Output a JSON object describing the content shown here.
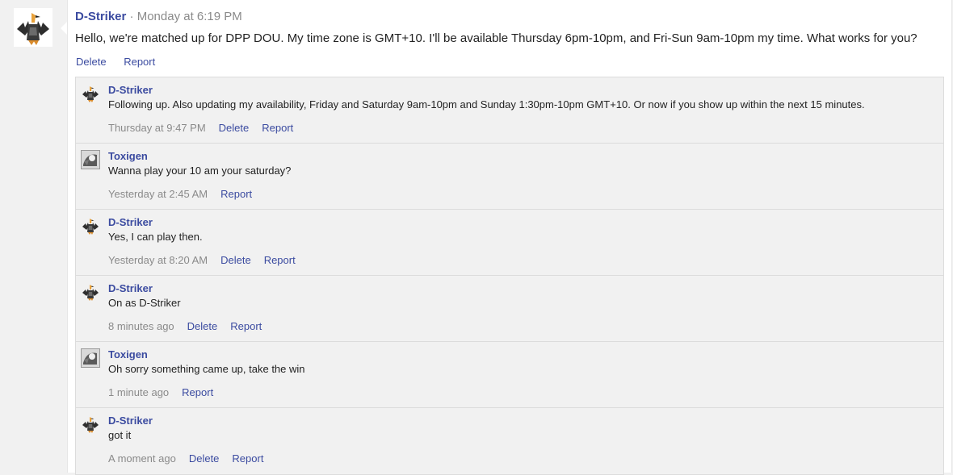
{
  "main_post": {
    "author": "D-Striker",
    "separator": "·",
    "time": "Monday at 6:19 PM",
    "body": "Hello, we're matched up for DPP DOU. My time zone is GMT+10. I'll be available Thursday 6pm-10pm, and Fri-Sun 9am-10pm my time. What works for you?",
    "actions": {
      "delete": "Delete",
      "report": "Report"
    }
  },
  "replies": [
    {
      "author": "D-Striker",
      "avatar": "striker",
      "text": "Following up. Also updating my availability, Friday and Saturday 9am-10pm and Sunday 1:30pm-10pm GMT+10. Or now if you show up within the next 15 minutes.",
      "time": "Thursday at 9:47 PM",
      "delete": "Delete",
      "report": "Report"
    },
    {
      "author": "Toxigen",
      "avatar": "toxigen",
      "text": "Wanna play your 10 am your saturday?",
      "time": "Yesterday at 2:45 AM",
      "delete": null,
      "report": "Report"
    },
    {
      "author": "D-Striker",
      "avatar": "striker",
      "text": "Yes, I can play then.",
      "time": "Yesterday at 8:20 AM",
      "delete": "Delete",
      "report": "Report"
    },
    {
      "author": "D-Striker",
      "avatar": "striker",
      "text": "On as D-Striker",
      "time": "8 minutes ago",
      "delete": "Delete",
      "report": "Report"
    },
    {
      "author": "Toxigen",
      "avatar": "toxigen",
      "text": "Oh sorry something came up, take the win",
      "time": "1 minute ago",
      "delete": null,
      "report": "Report"
    },
    {
      "author": "D-Striker",
      "avatar": "striker",
      "text": "got it",
      "time": "A moment ago",
      "delete": "Delete",
      "report": "Report"
    }
  ],
  "colors": {
    "link": "#3b4ba0",
    "muted": "#8a8a8a",
    "reply_bg": "#f1f1f1"
  }
}
